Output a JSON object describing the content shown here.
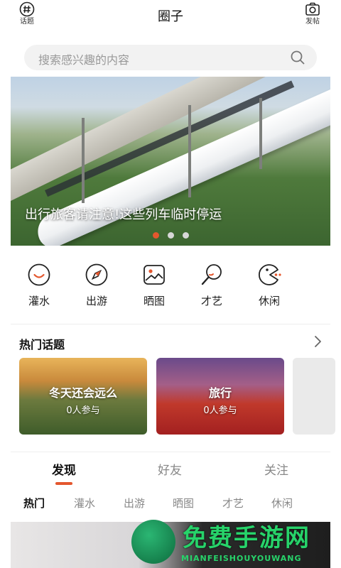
{
  "header": {
    "title": "圈子",
    "left_label": "话题",
    "right_label": "发帖"
  },
  "search": {
    "placeholder": "搜索感兴趣的内容"
  },
  "banner": {
    "caption": "出行旅客请注意!这些列车临时停运",
    "slides": 3,
    "active_slide": 1
  },
  "categories": [
    {
      "label": "灌水",
      "icon": "smile-bubble-icon"
    },
    {
      "label": "出游",
      "icon": "compass-icon"
    },
    {
      "label": "晒图",
      "icon": "picture-icon"
    },
    {
      "label": "才艺",
      "icon": "microphone-icon"
    },
    {
      "label": "休闲",
      "icon": "pacman-icon"
    }
  ],
  "hot_topics": {
    "heading": "热门话题",
    "items": [
      {
        "title": "冬天还会远么",
        "participants": "0人参与"
      },
      {
        "title": "旅行",
        "participants": "0人参与"
      }
    ]
  },
  "main_tabs": {
    "items": [
      "发现",
      "好友",
      "关注"
    ],
    "active": "发现"
  },
  "sub_tabs": {
    "items": [
      "热门",
      "灌水",
      "出游",
      "晒图",
      "才艺",
      "休闲"
    ],
    "active": "热门"
  },
  "watermark": {
    "text": "免费手游网",
    "url_text": "MIANFEISHOUYOUWANG"
  },
  "colors": {
    "accent": "#e4572e",
    "icon_stroke": "#222222"
  }
}
